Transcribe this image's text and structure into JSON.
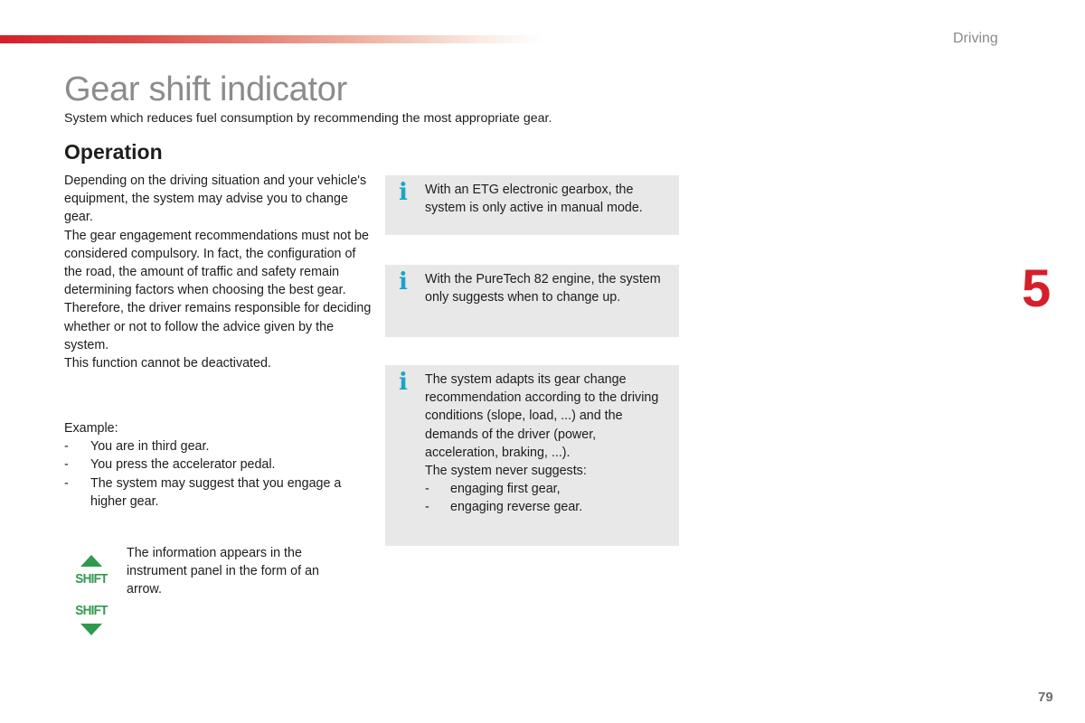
{
  "header": {
    "section_label": "Driving",
    "accent_color": "#d51f2b"
  },
  "title": "Gear shift indicator",
  "subtitle": "System which reduces fuel consumption by recommending the most appropriate gear.",
  "operation": {
    "heading": "Operation",
    "paragraphs": [
      "Depending on the driving situation and your vehicle's equipment, the system may advise you to change gear.",
      "The gear engagement recommendations must not be considered compulsory. In fact, the configuration of the road, the amount of traffic and safety remain determining factors when choosing the best gear. Therefore, the driver remains responsible for deciding whether or not to follow the advice given by the system.",
      "This function cannot be deactivated."
    ],
    "example": {
      "label": "Example:",
      "items": [
        "You are in third gear.",
        "You press the accelerator pedal.",
        "The system may suggest that you engage a higher gear."
      ]
    },
    "shift_indicator": {
      "up_label": "SHIFT",
      "down_label": "SHIFT",
      "color": "#2f9a4e",
      "caption": "The information appears in the instrument panel in the form of an arrow."
    }
  },
  "info_boxes": [
    {
      "icon": "info-icon",
      "lines": [
        "With an ETG electronic gearbox, the system is only active in manual mode."
      ]
    },
    {
      "icon": "info-icon",
      "lines": [
        "With the PureTech 82 engine, the system only suggests when to change up."
      ]
    },
    {
      "icon": "info-icon",
      "lines": [
        "The system adapts its gear change recommendation according to the driving conditions (slope, load, ...) and the demands of the driver (power, acceleration, braking, ...).",
        "The system never suggests:"
      ],
      "items": [
        "engaging first gear,",
        "engaging reverse gear."
      ]
    }
  ],
  "list_marker": "-",
  "info_icon_glyph": "i",
  "chapter_number": "5",
  "page_number": "79"
}
